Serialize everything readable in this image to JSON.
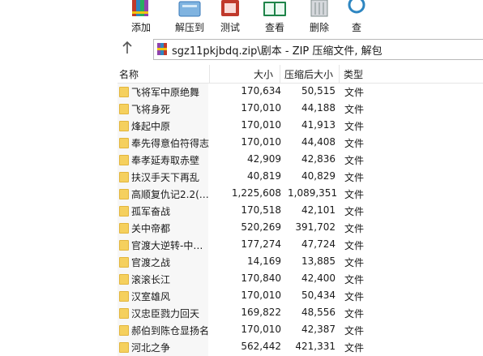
{
  "toolbar": {
    "buttons": [
      {
        "label": "添加",
        "icon": "add-books-icon"
      },
      {
        "label": "解压到",
        "icon": "extract-folder-icon"
      },
      {
        "label": "测试",
        "icon": "test-icon"
      },
      {
        "label": "查看",
        "icon": "view-book-icon"
      },
      {
        "label": "删除",
        "icon": "delete-icon"
      },
      {
        "label": "查",
        "icon": "find-icon"
      }
    ]
  },
  "address": {
    "back_icon": "up-arrow-icon",
    "path": "sgz11pkjbdq.zip\\剧本 - ZIP 压缩文件, 解包"
  },
  "columns": {
    "name": "名称",
    "size": "大小",
    "compressed": "压缩后大小",
    "type": "类型"
  },
  "colors": {
    "folder": "#f5d05e",
    "border": "#b9b9b9"
  },
  "files": [
    {
      "name": "飞将军中原绝舞",
      "size": "170,634",
      "compressed": "50,515",
      "type": "文件"
    },
    {
      "name": "飞将身死",
      "size": "170,010",
      "compressed": "44,188",
      "type": "文件"
    },
    {
      "name": "烽起中原",
      "size": "170,010",
      "compressed": "41,913",
      "type": "文件"
    },
    {
      "name": "奉先得意伯符得志",
      "size": "170,010",
      "compressed": "44,408",
      "type": "文件"
    },
    {
      "name": "奉孝延寿取赤壁",
      "size": "42,909",
      "compressed": "42,836",
      "type": "文件"
    },
    {
      "name": "扶汉手天下再乱",
      "size": "40,819",
      "compressed": "40,829",
      "type": "文件"
    },
    {
      "name": "高顺复仇记2.2(…",
      "size": "1,225,608",
      "compressed": "1,089,351",
      "type": "文件"
    },
    {
      "name": "孤军奋战",
      "size": "170,518",
      "compressed": "42,101",
      "type": "文件"
    },
    {
      "name": "关中帝都",
      "size": "520,269",
      "compressed": "391,702",
      "type": "文件"
    },
    {
      "name": "官渡大逆转-中…",
      "size": "177,274",
      "compressed": "47,724",
      "type": "文件"
    },
    {
      "name": "官渡之战",
      "size": "14,169",
      "compressed": "13,885",
      "type": "文件"
    },
    {
      "name": "滚滚长江",
      "size": "170,840",
      "compressed": "42,400",
      "type": "文件"
    },
    {
      "name": "汉室雄风",
      "size": "170,010",
      "compressed": "50,434",
      "type": "文件"
    },
    {
      "name": "汉忠臣戮力回天",
      "size": "169,822",
      "compressed": "48,556",
      "type": "文件"
    },
    {
      "name": "郝伯到陈仓显扬名",
      "size": "170,010",
      "compressed": "42,387",
      "type": "文件"
    },
    {
      "name": "河北之争",
      "size": "562,442",
      "compressed": "421,331",
      "type": "文件"
    }
  ]
}
